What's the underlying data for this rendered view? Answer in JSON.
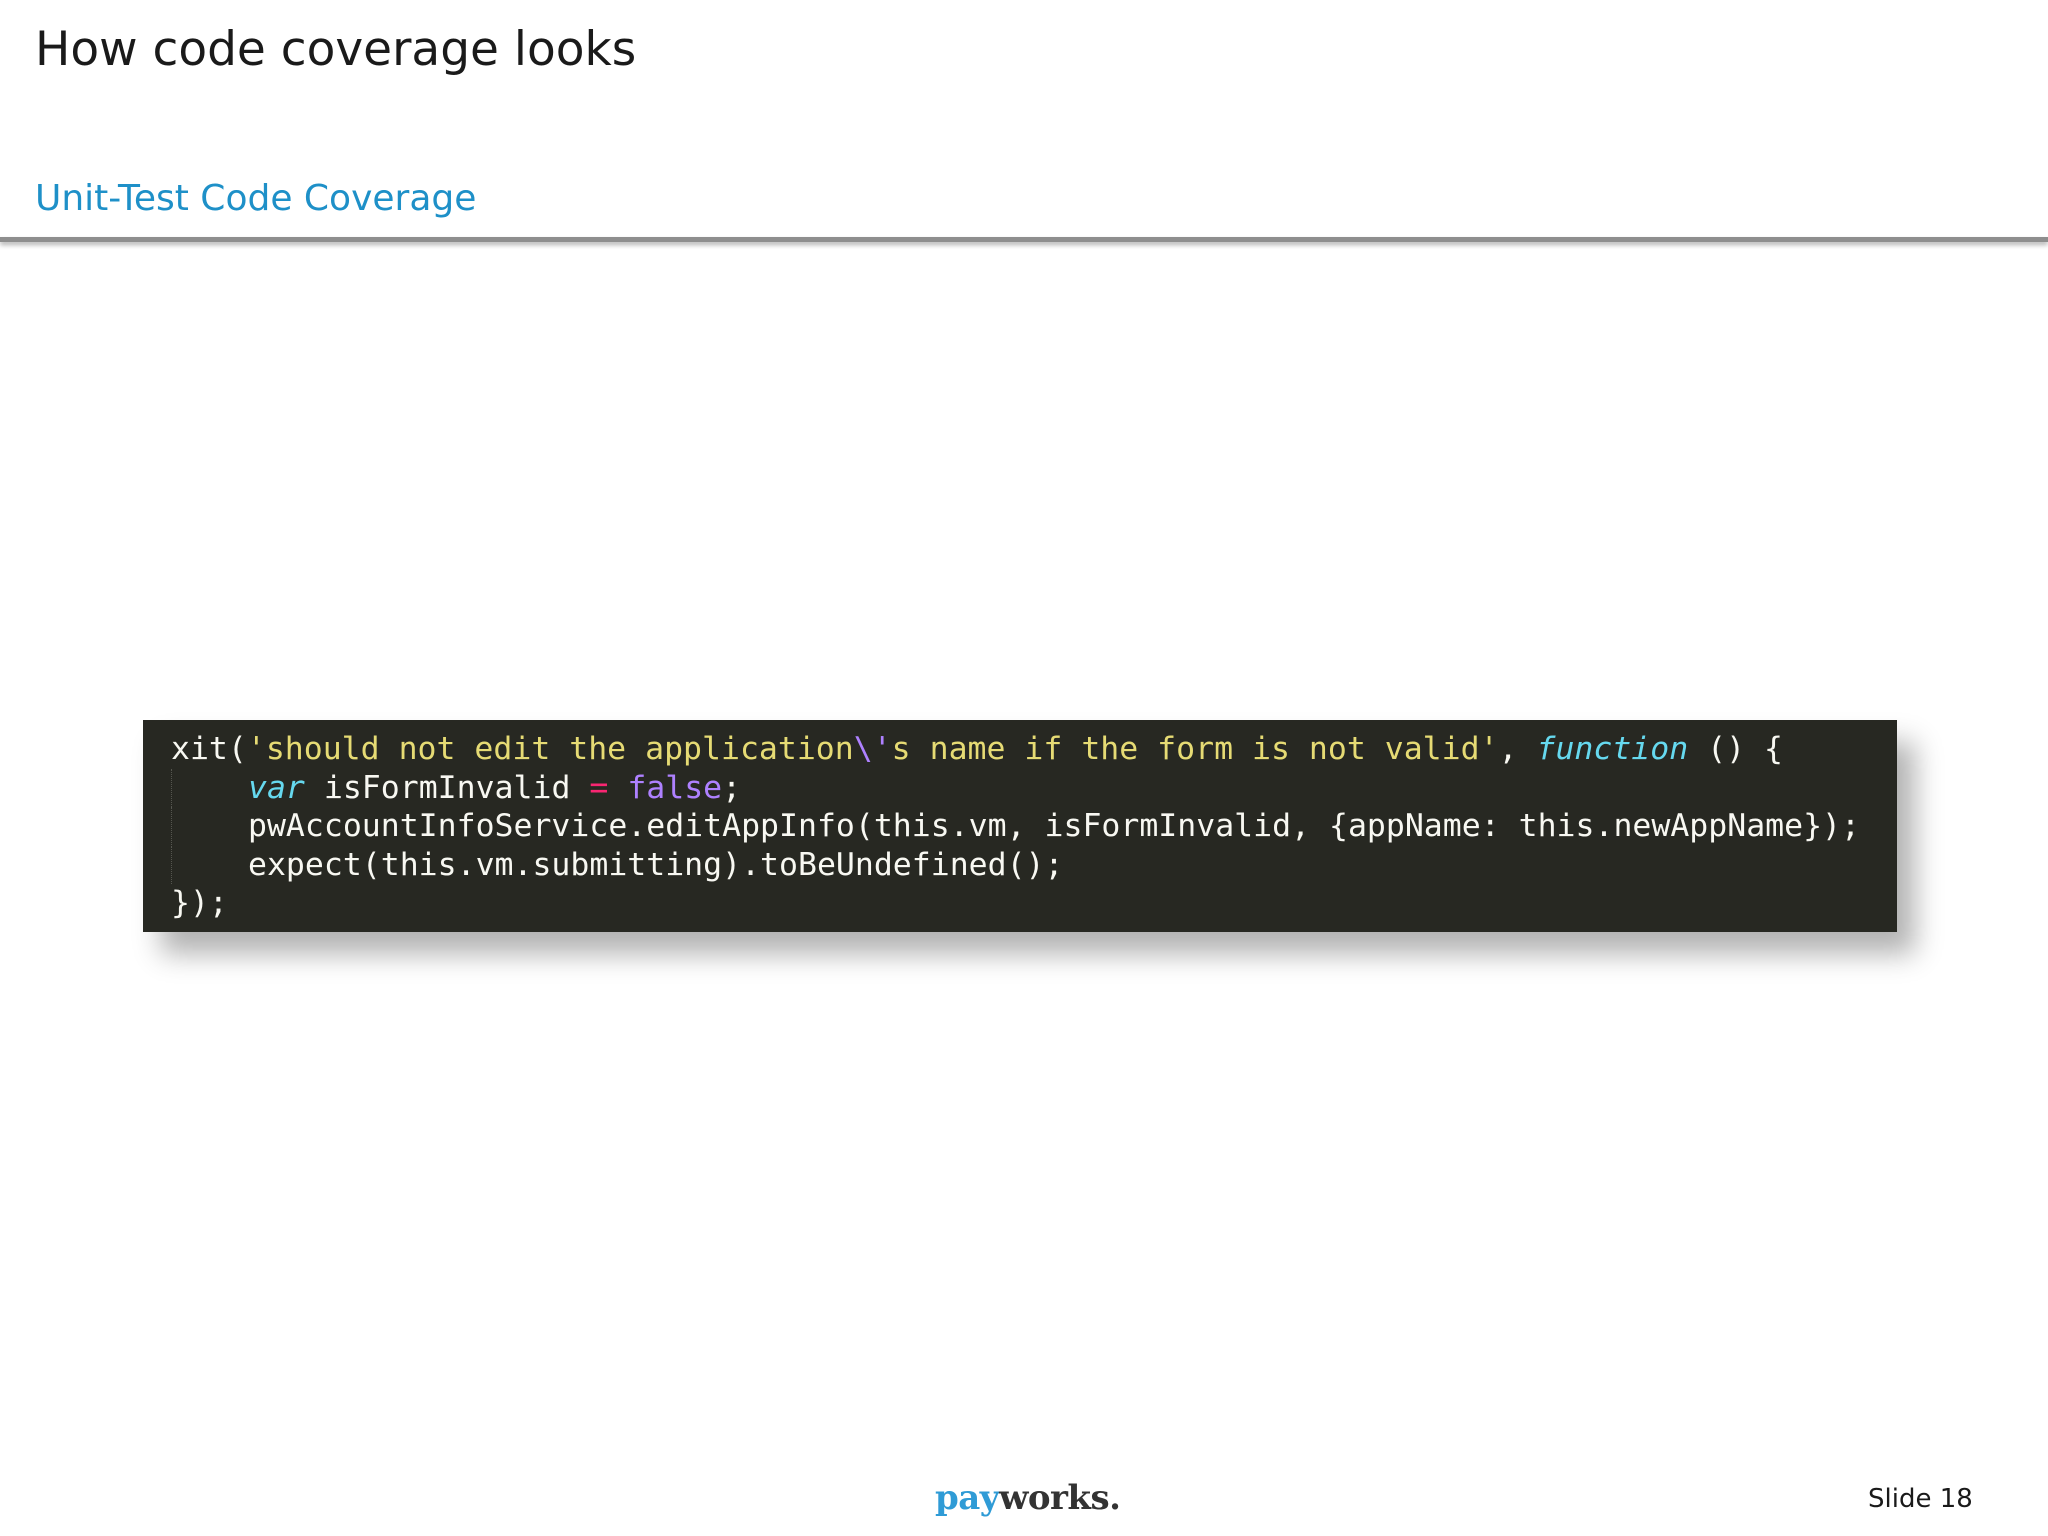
{
  "slide": {
    "title": "How code coverage looks",
    "subtitle": "Unit-Test Code Coverage",
    "number_label": "Slide 18"
  },
  "code": {
    "line1": {
      "a": "xit(",
      "b": "'should not edit the application",
      "c": "\\'",
      "d": "s name if the form is not valid'",
      "e": ", ",
      "f": "function",
      "g": " () {"
    },
    "line2": {
      "a": "var",
      "b": " isFormInvalid ",
      "c": "=",
      "d": " ",
      "e": "false",
      "f": ";"
    },
    "line3": {
      "a": "pwAccountInfoService.editAppInfo(this.vm, isFormInvalid, {appName: this.newAppName});"
    },
    "line4": {
      "a": "expect(this.vm.submitting).toBeUndefined();"
    },
    "line5": {
      "a": "});"
    }
  },
  "footer": {
    "logo_part1": "pay",
    "logo_part2": "works."
  },
  "colors": {
    "accent": "#1e90c8",
    "code_background": "#272822",
    "string": "#e6db74",
    "keyword": "#66d9ef",
    "operator": "#f92672",
    "constant": "#ae81ff"
  }
}
